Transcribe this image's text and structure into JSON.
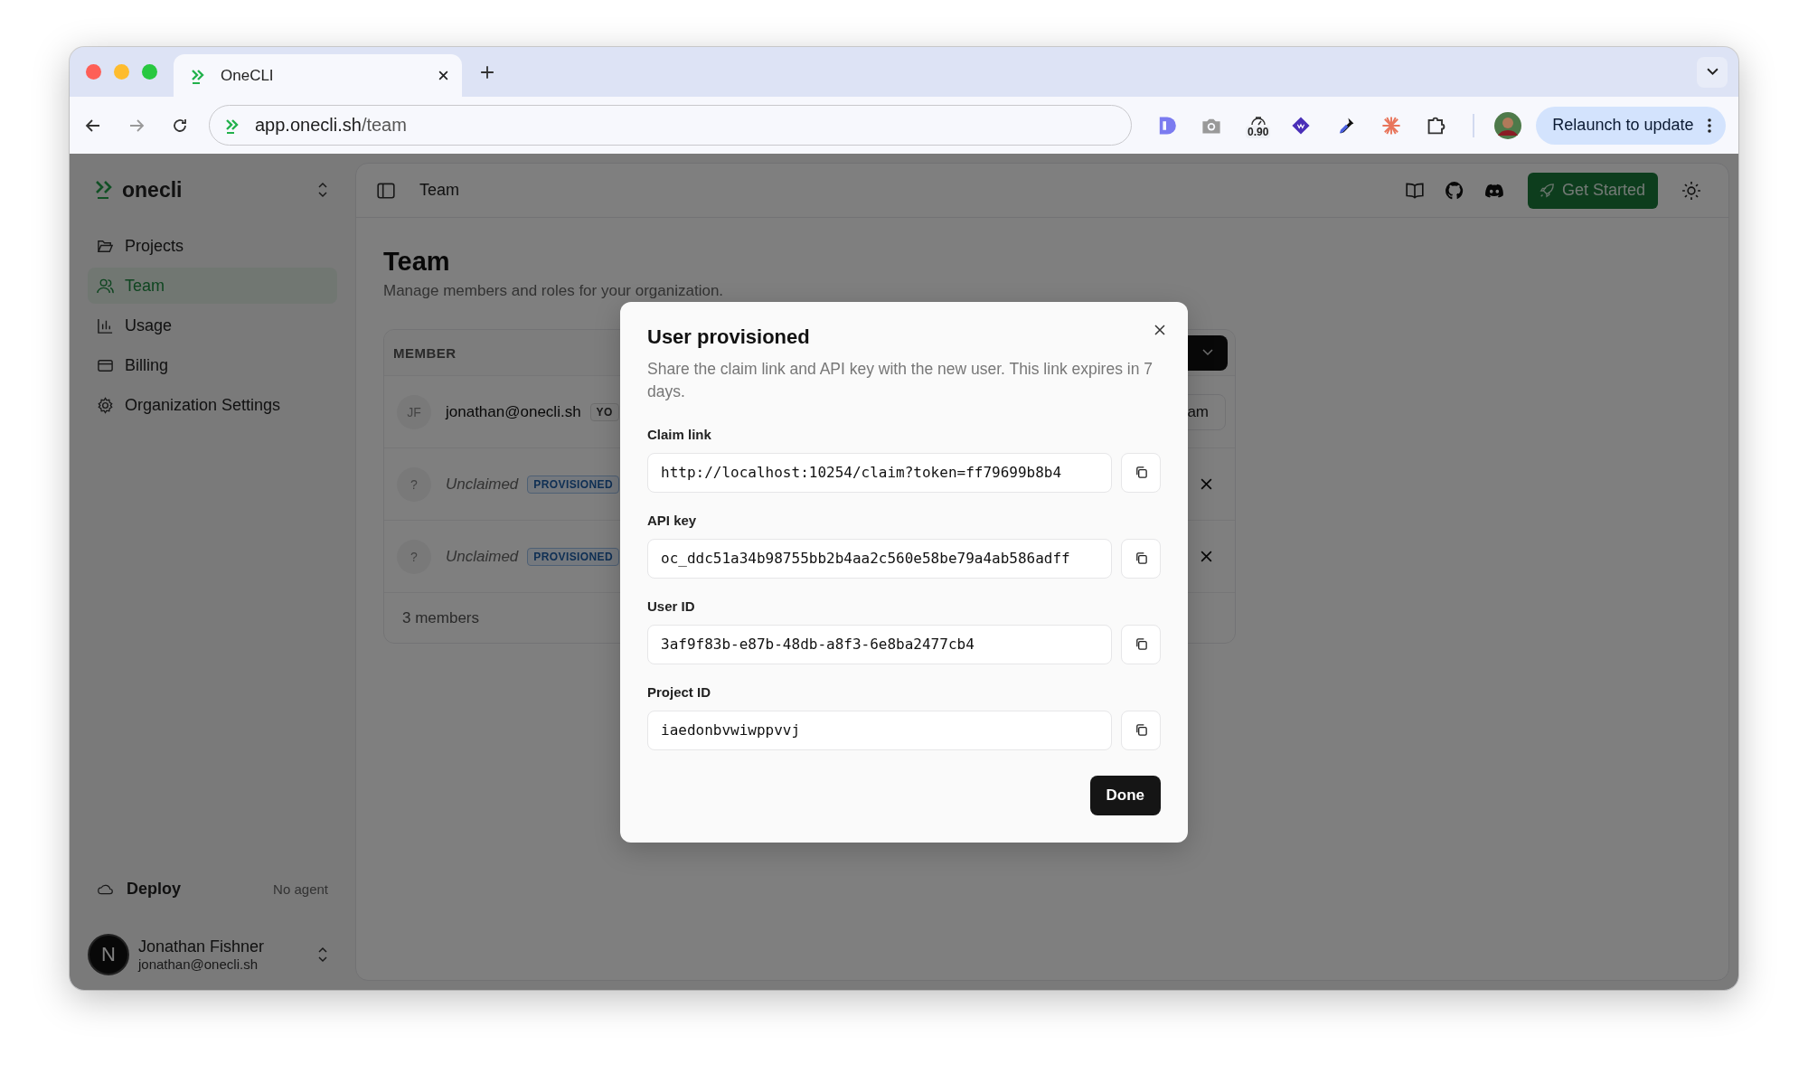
{
  "browser": {
    "tabs": [
      {
        "title": "OneCLI",
        "selected": true
      }
    ],
    "address": {
      "host": "app.onecli.sh",
      "path": "/team"
    },
    "extension_badge": "0.90",
    "relaunch": "Relaunch to update"
  },
  "sidebar": {
    "brand": "onecli",
    "items": [
      {
        "label": "Projects",
        "selected": false
      },
      {
        "label": "Team",
        "selected": true
      },
      {
        "label": "Usage",
        "selected": false
      },
      {
        "label": "Billing",
        "selected": false
      },
      {
        "label": "Organization Settings",
        "selected": false
      }
    ],
    "deploy": {
      "label": "Deploy",
      "status": "No agent"
    },
    "user": {
      "initial": "N",
      "name": "Jonathan Fishner",
      "email": "jonathan@onecli.sh"
    }
  },
  "header": {
    "title": "Team",
    "cta": "Get Started"
  },
  "page": {
    "title": "Team",
    "subtitle": "Manage members and roles for your organization.",
    "table": {
      "column": "MEMBER",
      "rows": [
        {
          "kind": "member",
          "avatar": "JF",
          "name": "jonathan@onecli.sh",
          "badge": "YO",
          "role": "am"
        },
        {
          "kind": "unclaimed",
          "avatar": "?",
          "name": "Unclaimed",
          "badge": "PROVISIONED"
        },
        {
          "kind": "unclaimed",
          "avatar": "?",
          "name": "Unclaimed",
          "badge": "PROVISIONED"
        }
      ],
      "footer": "3 members"
    }
  },
  "dialog": {
    "title": "User provisioned",
    "description": "Share the claim link and API key with the new user. This link expires in 7 days.",
    "fields": [
      {
        "label": "Claim link",
        "value": "http://localhost:10254/claim?token=ff79699b8b4"
      },
      {
        "label": "API key",
        "value": "oc_ddc51a34b98755bb2b4aa2c560e58be79a4ab586adff"
      },
      {
        "label": "User ID",
        "value": "3af9f83b-e87b-48db-a8f3-6e8ba2477cb4"
      },
      {
        "label": "Project ID",
        "value": "iaedonbvwiwppvvj"
      }
    ],
    "button": "Done"
  }
}
